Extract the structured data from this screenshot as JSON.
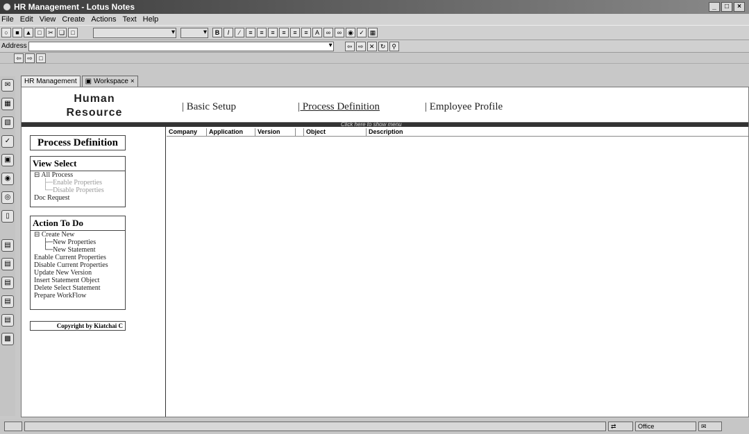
{
  "window": {
    "title": "HR Management - Lotus Notes"
  },
  "menu": [
    "File",
    "Edit",
    "View",
    "Create",
    "Actions",
    "Text",
    "Help"
  ],
  "address": {
    "label": "Address",
    "value": ""
  },
  "tabs": [
    {
      "label": "HR Management"
    },
    {
      "label": "Workspace"
    }
  ],
  "brand": {
    "line1": "Human",
    "line2": "Resource"
  },
  "nav": {
    "basic_setup": "| Basic Setup",
    "process_definition": "| Process Definition",
    "employee_profile": "| Employee Profile"
  },
  "menu_bar_hint": "Click here to show menu",
  "sidebar": {
    "title": "Process Definition",
    "view_select": {
      "header": "View Select",
      "items": [
        "⊟ All Process",
        "├─Enable Properties",
        "└─Disable Properties",
        "Doc Request"
      ]
    },
    "action_to_do": {
      "header": "Action To Do",
      "items": [
        "⊟ Create New",
        "├─New Properties",
        "└─New Statement",
        "Enable Current Properties",
        "Disable Current Properties",
        "Update New Version",
        "Insert Statement Object",
        "Delete Select Statement",
        "Prepare WorkFlow"
      ]
    },
    "copyright": "Copyright by Kiatchai C"
  },
  "table": {
    "columns": [
      "Company",
      "Application",
      "Version",
      "",
      "Object",
      "Description"
    ]
  },
  "status": {
    "location": "Office"
  }
}
